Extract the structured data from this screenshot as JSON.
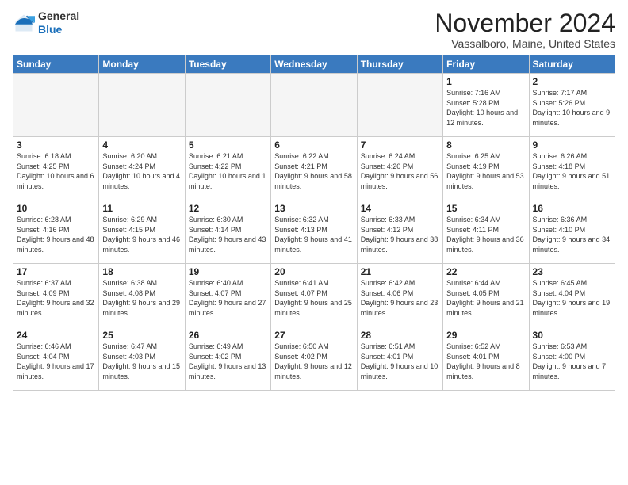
{
  "logo": {
    "general": "General",
    "blue": "Blue"
  },
  "header": {
    "month": "November 2024",
    "location": "Vassalboro, Maine, United States"
  },
  "weekdays": [
    "Sunday",
    "Monday",
    "Tuesday",
    "Wednesday",
    "Thursday",
    "Friday",
    "Saturday"
  ],
  "weeks": [
    [
      {
        "day": "",
        "empty": true
      },
      {
        "day": "",
        "empty": true
      },
      {
        "day": "",
        "empty": true
      },
      {
        "day": "",
        "empty": true
      },
      {
        "day": "",
        "empty": true
      },
      {
        "day": "1",
        "sunrise": "7:16 AM",
        "sunset": "5:28 PM",
        "daylight": "10 hours and 12 minutes."
      },
      {
        "day": "2",
        "sunrise": "7:17 AM",
        "sunset": "5:26 PM",
        "daylight": "10 hours and 9 minutes."
      }
    ],
    [
      {
        "day": "3",
        "sunrise": "6:18 AM",
        "sunset": "4:25 PM",
        "daylight": "10 hours and 6 minutes."
      },
      {
        "day": "4",
        "sunrise": "6:20 AM",
        "sunset": "4:24 PM",
        "daylight": "10 hours and 4 minutes."
      },
      {
        "day": "5",
        "sunrise": "6:21 AM",
        "sunset": "4:22 PM",
        "daylight": "10 hours and 1 minute."
      },
      {
        "day": "6",
        "sunrise": "6:22 AM",
        "sunset": "4:21 PM",
        "daylight": "9 hours and 58 minutes."
      },
      {
        "day": "7",
        "sunrise": "6:24 AM",
        "sunset": "4:20 PM",
        "daylight": "9 hours and 56 minutes."
      },
      {
        "day": "8",
        "sunrise": "6:25 AM",
        "sunset": "4:19 PM",
        "daylight": "9 hours and 53 minutes."
      },
      {
        "day": "9",
        "sunrise": "6:26 AM",
        "sunset": "4:18 PM",
        "daylight": "9 hours and 51 minutes."
      }
    ],
    [
      {
        "day": "10",
        "sunrise": "6:28 AM",
        "sunset": "4:16 PM",
        "daylight": "9 hours and 48 minutes."
      },
      {
        "day": "11",
        "sunrise": "6:29 AM",
        "sunset": "4:15 PM",
        "daylight": "9 hours and 46 minutes."
      },
      {
        "day": "12",
        "sunrise": "6:30 AM",
        "sunset": "4:14 PM",
        "daylight": "9 hours and 43 minutes."
      },
      {
        "day": "13",
        "sunrise": "6:32 AM",
        "sunset": "4:13 PM",
        "daylight": "9 hours and 41 minutes."
      },
      {
        "day": "14",
        "sunrise": "6:33 AM",
        "sunset": "4:12 PM",
        "daylight": "9 hours and 38 minutes."
      },
      {
        "day": "15",
        "sunrise": "6:34 AM",
        "sunset": "4:11 PM",
        "daylight": "9 hours and 36 minutes."
      },
      {
        "day": "16",
        "sunrise": "6:36 AM",
        "sunset": "4:10 PM",
        "daylight": "9 hours and 34 minutes."
      }
    ],
    [
      {
        "day": "17",
        "sunrise": "6:37 AM",
        "sunset": "4:09 PM",
        "daylight": "9 hours and 32 minutes."
      },
      {
        "day": "18",
        "sunrise": "6:38 AM",
        "sunset": "4:08 PM",
        "daylight": "9 hours and 29 minutes."
      },
      {
        "day": "19",
        "sunrise": "6:40 AM",
        "sunset": "4:07 PM",
        "daylight": "9 hours and 27 minutes."
      },
      {
        "day": "20",
        "sunrise": "6:41 AM",
        "sunset": "4:07 PM",
        "daylight": "9 hours and 25 minutes."
      },
      {
        "day": "21",
        "sunrise": "6:42 AM",
        "sunset": "4:06 PM",
        "daylight": "9 hours and 23 minutes."
      },
      {
        "day": "22",
        "sunrise": "6:44 AM",
        "sunset": "4:05 PM",
        "daylight": "9 hours and 21 minutes."
      },
      {
        "day": "23",
        "sunrise": "6:45 AM",
        "sunset": "4:04 PM",
        "daylight": "9 hours and 19 minutes."
      }
    ],
    [
      {
        "day": "24",
        "sunrise": "6:46 AM",
        "sunset": "4:04 PM",
        "daylight": "9 hours and 17 minutes."
      },
      {
        "day": "25",
        "sunrise": "6:47 AM",
        "sunset": "4:03 PM",
        "daylight": "9 hours and 15 minutes."
      },
      {
        "day": "26",
        "sunrise": "6:49 AM",
        "sunset": "4:02 PM",
        "daylight": "9 hours and 13 minutes."
      },
      {
        "day": "27",
        "sunrise": "6:50 AM",
        "sunset": "4:02 PM",
        "daylight": "9 hours and 12 minutes."
      },
      {
        "day": "28",
        "sunrise": "6:51 AM",
        "sunset": "4:01 PM",
        "daylight": "9 hours and 10 minutes."
      },
      {
        "day": "29",
        "sunrise": "6:52 AM",
        "sunset": "4:01 PM",
        "daylight": "9 hours and 8 minutes."
      },
      {
        "day": "30",
        "sunrise": "6:53 AM",
        "sunset": "4:00 PM",
        "daylight": "9 hours and 7 minutes."
      }
    ]
  ]
}
